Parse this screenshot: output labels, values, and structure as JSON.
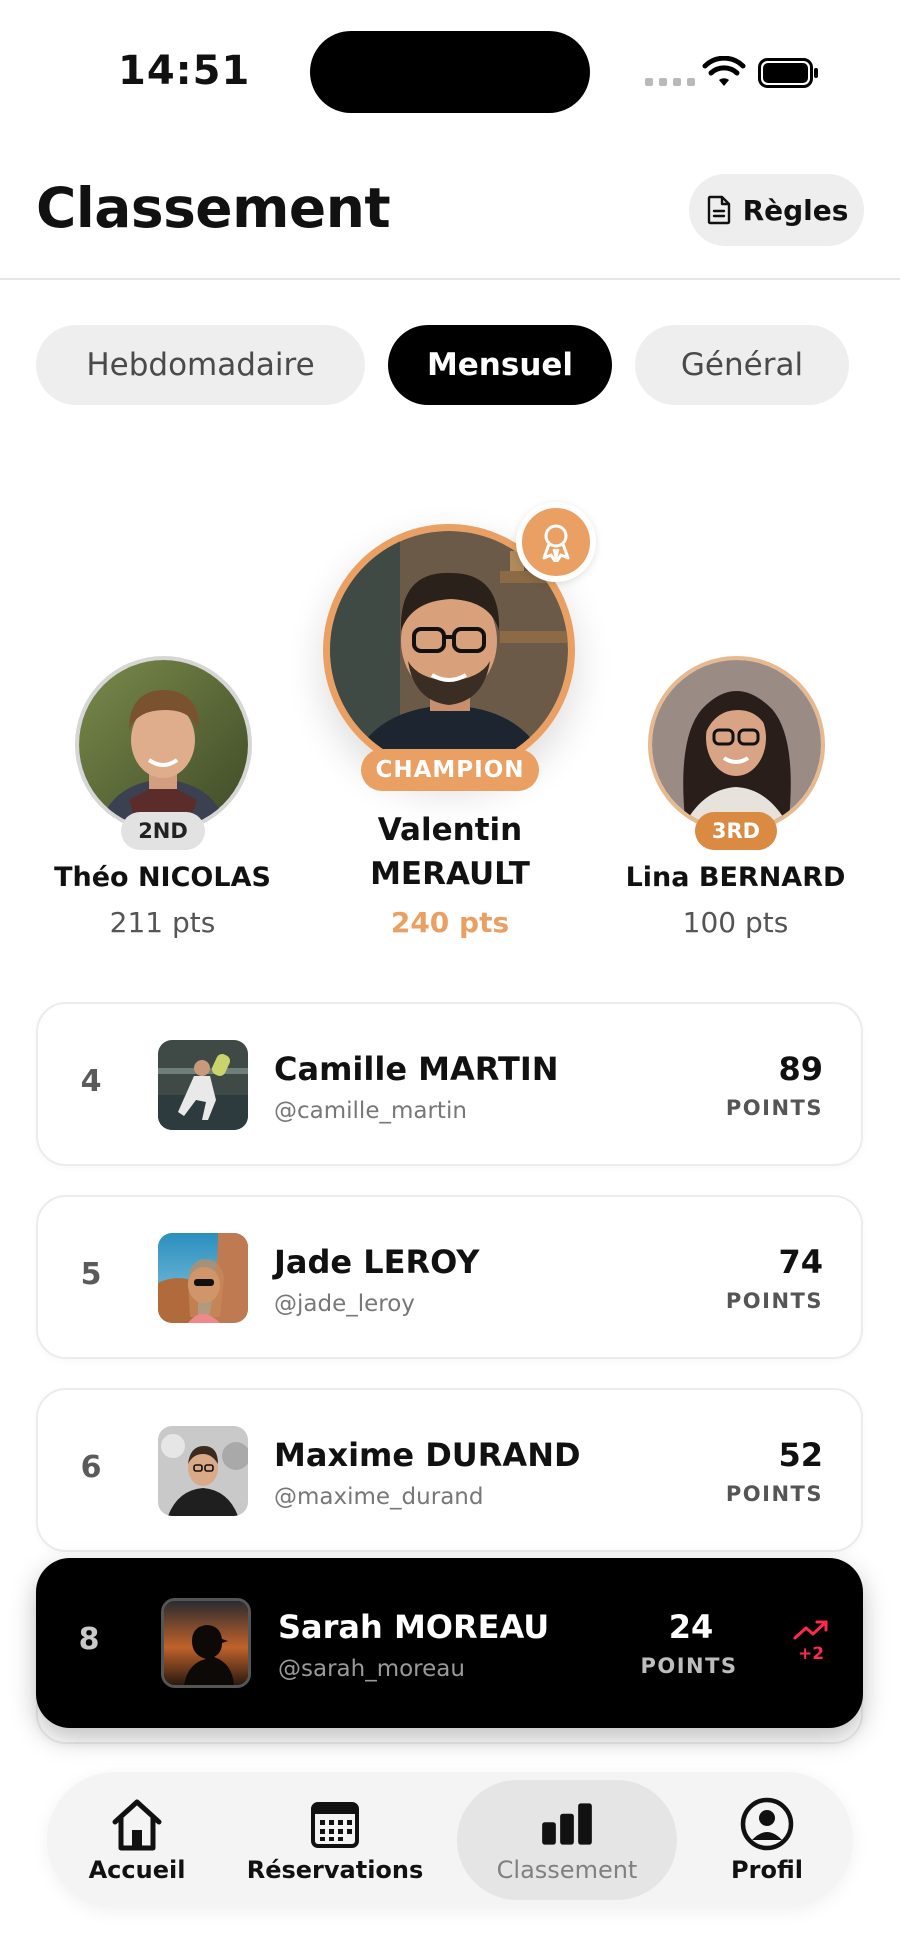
{
  "status": {
    "time": "14:51"
  },
  "header": {
    "title": "Classement",
    "rules_label": "Règles"
  },
  "tabs": [
    {
      "label": "Hebdomadaire",
      "active": false
    },
    {
      "label": "Mensuel",
      "active": true
    },
    {
      "label": "Général",
      "active": false
    }
  ],
  "podium": {
    "first": {
      "badge": "CHAMPION",
      "name_line1": "Valentin",
      "name_line2": "MERAULT",
      "points": "240 pts"
    },
    "second": {
      "badge": "2ND",
      "name": "Théo NICOLAS",
      "points": "211 pts"
    },
    "third": {
      "badge": "3RD",
      "name": "Lina BERNARD",
      "points": "100 pts"
    }
  },
  "ranking": [
    {
      "rank": "4",
      "name": "Camille MARTIN",
      "handle": "@camille_martin",
      "score": "89",
      "score_label": "POINTS"
    },
    {
      "rank": "5",
      "name": "Jade LEROY",
      "handle": "@jade_leroy",
      "score": "74",
      "score_label": "POINTS"
    },
    {
      "rank": "6",
      "name": "Maxime DURAND",
      "handle": "@maxime_durand",
      "score": "52",
      "score_label": "POINTS"
    }
  ],
  "current_user": {
    "rank": "8",
    "name": "Sarah MOREAU",
    "handle": "@sarah_moreau",
    "score": "24",
    "score_label": "POINTS",
    "trend": "+2"
  },
  "nav": [
    {
      "label": "Accueil",
      "icon": "home-icon",
      "active": false
    },
    {
      "label": "Réservations",
      "icon": "calendar-icon",
      "active": false
    },
    {
      "label": "Classement",
      "icon": "bar-chart-icon",
      "active": true
    },
    {
      "label": "Profil",
      "icon": "profile-icon",
      "active": false
    }
  ],
  "colors": {
    "accent": "#E9A062",
    "accent_dark": "#DB8A42",
    "trend_red": "#FF2A4A",
    "surface": "#EEEEEE"
  }
}
